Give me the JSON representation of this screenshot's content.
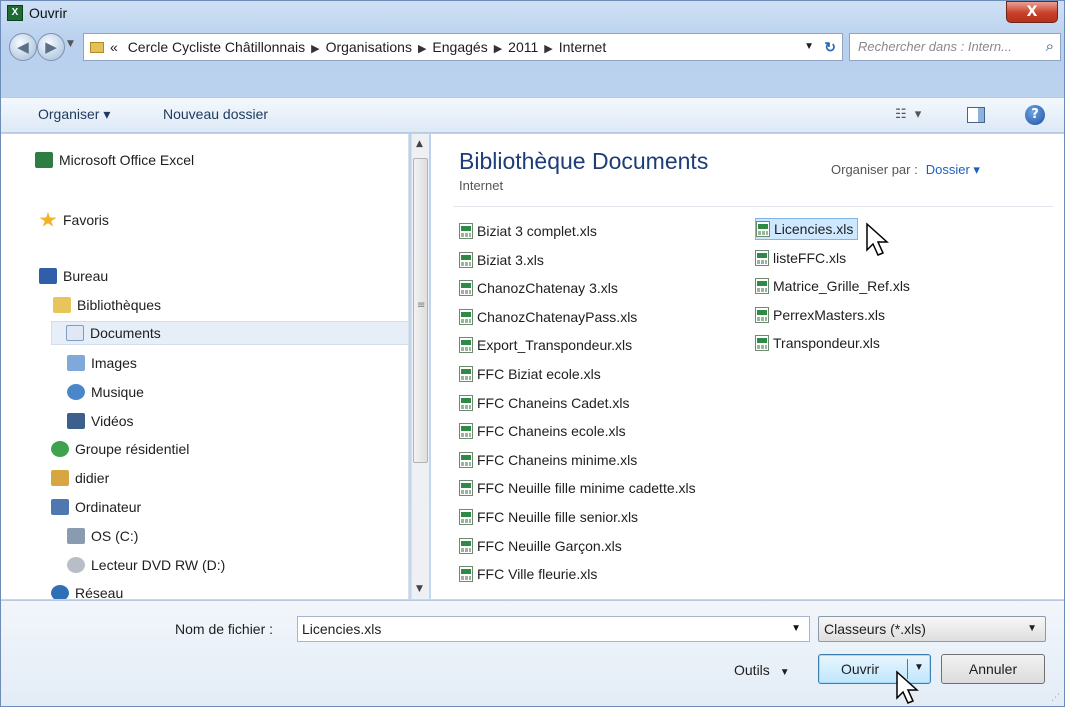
{
  "window": {
    "title": "Ouvrir",
    "close_label": "X"
  },
  "address": {
    "back_icon": "back-arrow-icon",
    "forward_icon": "forward-arrow-icon",
    "overflow": "«",
    "crumbs": [
      "Cercle Cycliste Châtillonnais",
      "Organisations",
      "Engagés",
      "2011",
      "Internet"
    ],
    "separator": "▶",
    "search_placeholder": "Rechercher dans : Intern..."
  },
  "toolbar": {
    "organiser": "Organiser ▾",
    "nouveau_dossier": "Nouveau dossier"
  },
  "sidebar": {
    "items": [
      {
        "label": "Microsoft Office Excel",
        "icon": "excel-icon"
      },
      {
        "label": "Favoris",
        "icon": "star-icon"
      },
      {
        "label": "Bureau",
        "icon": "desktop-icon"
      },
      {
        "label": "Bibliothèques",
        "icon": "libraries-icon"
      },
      {
        "label": "Documents",
        "icon": "documents-icon"
      },
      {
        "label": "Images",
        "icon": "images-icon"
      },
      {
        "label": "Musique",
        "icon": "music-icon"
      },
      {
        "label": "Vidéos",
        "icon": "videos-icon"
      },
      {
        "label": "Groupe résidentiel",
        "icon": "homegroup-icon"
      },
      {
        "label": "didier",
        "icon": "user-folder-icon"
      },
      {
        "label": "Ordinateur",
        "icon": "computer-icon"
      },
      {
        "label": "OS (C:)",
        "icon": "drive-icon"
      },
      {
        "label": "Lecteur DVD RW (D:)",
        "icon": "dvd-icon"
      },
      {
        "label": "Réseau",
        "icon": "network-icon"
      }
    ]
  },
  "main": {
    "library_title": "Bibliothèque Documents",
    "library_subtitle": "Internet",
    "arrange_label": "Organiser par :",
    "arrange_value": "Dossier ▾",
    "files_col1": [
      "Biziat 3 complet.xls",
      "Biziat 3.xls",
      "ChanozChatenay 3.xls",
      "ChanozChatenayPass.xls",
      "Export_Transpondeur.xls",
      "FFC Biziat ecole.xls",
      "FFC Chaneins Cadet.xls",
      "FFC Chaneins ecole.xls",
      "FFC Chaneins minime.xls",
      "FFC Neuille fille minime cadette.xls",
      "FFC Neuille fille senior.xls",
      "FFC Neuille Garçon.xls",
      "FFC Ville fleurie.xls"
    ],
    "files_col2": [
      "Licencies.xls",
      "listeFFC.xls",
      "Matrice_Grille_Ref.xls",
      "PerrexMasters.xls",
      "Transpondeur.xls"
    ],
    "selected_file": "Licencies.xls"
  },
  "bottom": {
    "filename_label": "Nom de fichier :",
    "filename_value": "Licencies.xls",
    "filter_value": "Classeurs (*.xls)",
    "tools_label": "Outils",
    "open_label": "Ouvrir",
    "cancel_label": "Annuler"
  },
  "colors": {
    "accent": "#1e3d76",
    "selection": "#cde8ff",
    "close": "#c9402a"
  }
}
